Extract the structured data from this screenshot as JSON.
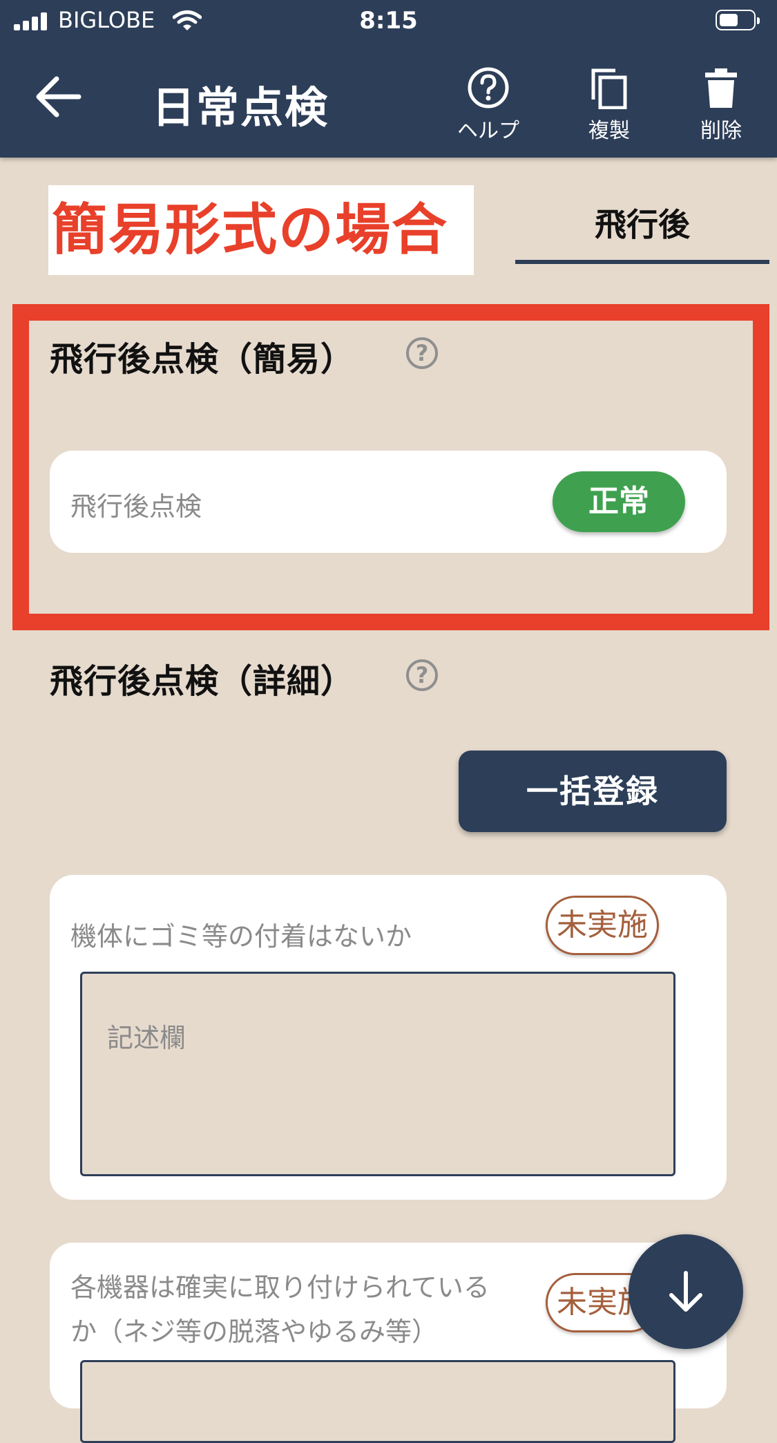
{
  "status_bar": {
    "carrier": "BIGLOBE",
    "time": "8:15"
  },
  "header": {
    "title": "日常点検",
    "actions": {
      "help": "ヘルプ",
      "duplicate": "複製",
      "delete": "削除"
    }
  },
  "annotation_label": "簡易形式の場合",
  "tab": {
    "label": "飛行後"
  },
  "simple_section": {
    "title": "飛行後点検（簡易）",
    "help_symbol": "?",
    "item_label": "飛行後点検",
    "status": "正常"
  },
  "detail_section": {
    "title": "飛行後点検（詳細）",
    "help_symbol": "?",
    "bulk_button": "一括登録",
    "items": [
      {
        "question": "機体にゴミ等の付着はないか",
        "status": "未実施",
        "placeholder": "記述欄"
      },
      {
        "question_line1": "各機器は確実に取り付けられている",
        "question_line2": "か（ネジ等の脱落やゆるみ等）",
        "status": "未実施"
      }
    ]
  },
  "colors": {
    "header_bg": "#2d3e58",
    "page_bg": "#e6dacd",
    "accent_red": "#e8402a",
    "ok_green": "#3fa14f",
    "pending_brown": "#a45f3c"
  },
  "icons": [
    "back-arrow-icon",
    "help-icon",
    "copy-icon",
    "trash-icon",
    "arrow-down-icon",
    "signal-icon",
    "wifi-icon",
    "battery-icon"
  ]
}
